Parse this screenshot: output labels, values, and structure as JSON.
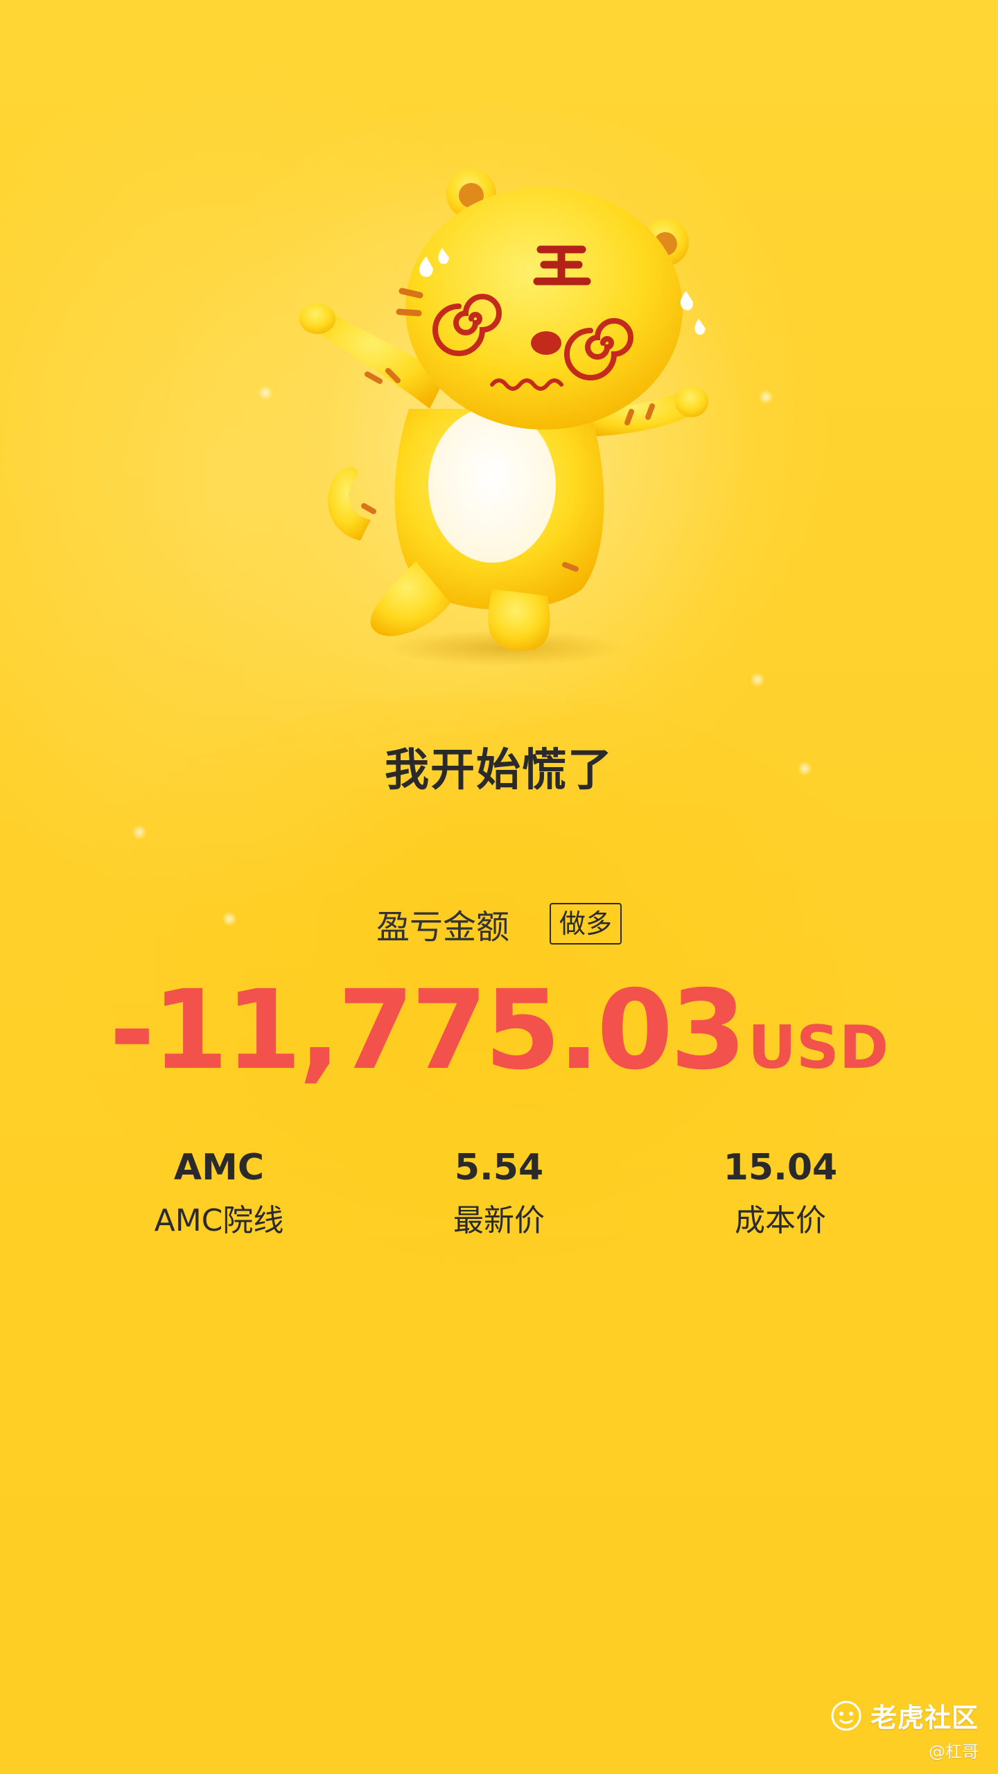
{
  "headline": "我开始慌了",
  "pnl": {
    "label": "盈亏金额",
    "direction": "做多",
    "amount": "-11,775.03",
    "currency": "USD",
    "amount_color": "#f2514c"
  },
  "stats": [
    {
      "value": "AMC",
      "label": "AMC院线"
    },
    {
      "value": "5.54",
      "label": "最新价"
    },
    {
      "value": "15.04",
      "label": "成本价"
    }
  ],
  "watermark": {
    "brand": "老虎社区",
    "author": "@杠哥",
    "logo_icon": "tiger-logo-icon"
  },
  "mascot": {
    "icon": "dizzy-tiger-mascot"
  },
  "colors": {
    "background": "#ffd12c",
    "text": "#2a2a2a",
    "loss": "#f2514c"
  }
}
